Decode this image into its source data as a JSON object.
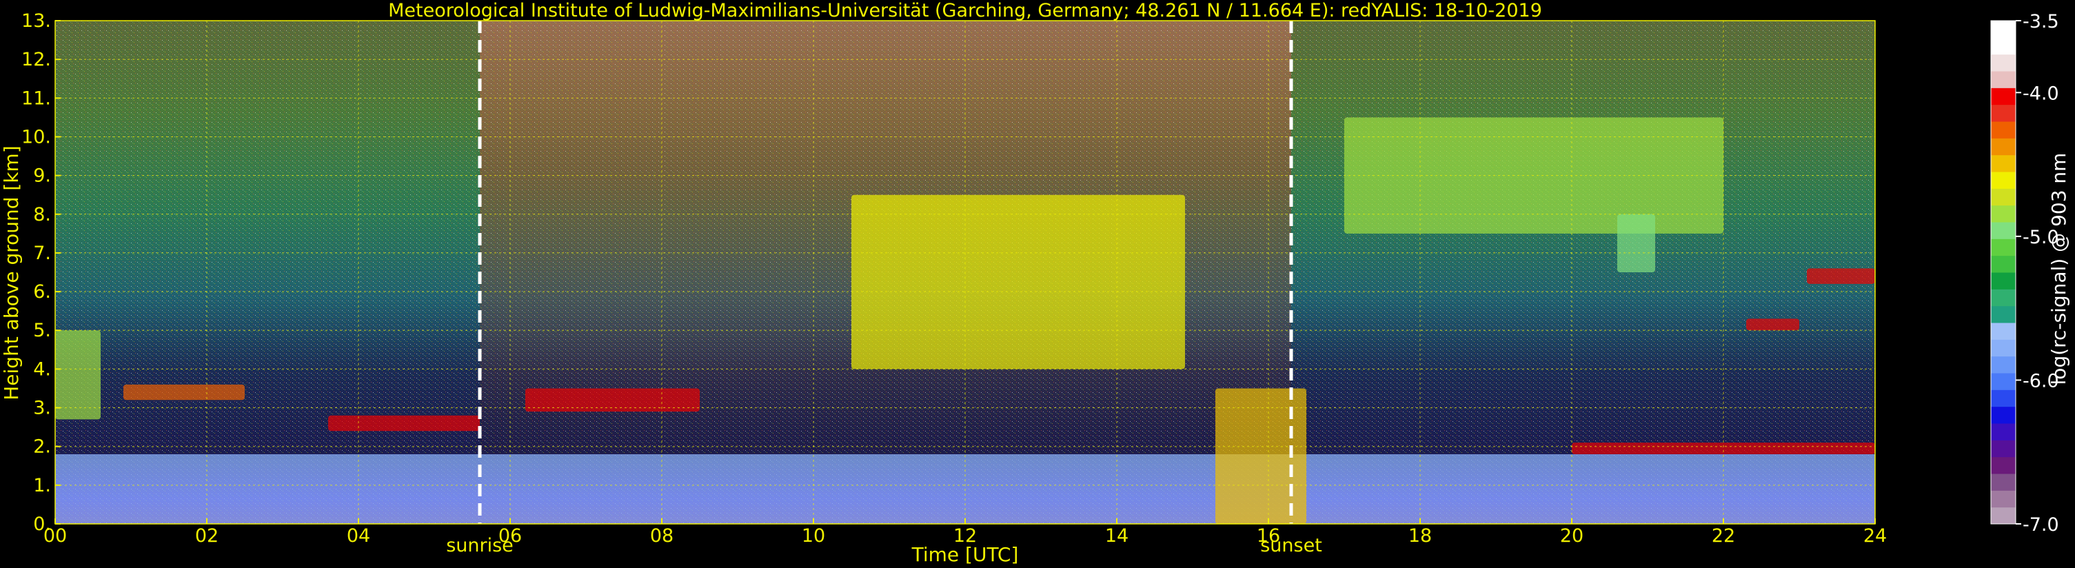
{
  "chart_data": {
    "type": "heatmap",
    "title": "Meteorological Institute of Ludwig-Maximilians-Universität (Garching, Germany; 48.261 N / 11.664 E):    redYALIS: 18-10-2019",
    "xlabel": "Time [UTC]",
    "ylabel": "Height above ground [km]",
    "xlim": [
      0,
      24
    ],
    "ylim": [
      0,
      13
    ],
    "x_ticks": [
      "00",
      "02",
      "04",
      "06",
      "08",
      "10",
      "12",
      "14",
      "16",
      "18",
      "20",
      "22",
      "24"
    ],
    "x_tick_values": [
      0,
      2,
      4,
      6,
      8,
      10,
      12,
      14,
      16,
      18,
      20,
      22,
      24
    ],
    "y_ticks": [
      "0.",
      "1.",
      "2.",
      "3.",
      "4.",
      "5.",
      "6.",
      "7.",
      "8.",
      "9.",
      "10.",
      "11.",
      "12.",
      "13."
    ],
    "y_tick_values": [
      0,
      1,
      2,
      3,
      4,
      5,
      6,
      7,
      8,
      9,
      10,
      11,
      12,
      13
    ],
    "grid": true,
    "markers": [
      {
        "label": "sunrise",
        "x": 5.6
      },
      {
        "label": "sunset",
        "x": 16.3
      }
    ],
    "colorbar": {
      "label": "log(rc-signal) @ 903 nm",
      "ticks": [
        "-3.5",
        "-4.0",
        "-5.0",
        "-6.0",
        "-7.0"
      ],
      "tick_values": [
        -3.5,
        -4.0,
        -5.0,
        -6.0,
        -7.0
      ],
      "range": [
        -7.0,
        -3.5
      ],
      "colors": [
        "#b8a0b8",
        "#a07aa0",
        "#80508a",
        "#6a1a7a",
        "#55109a",
        "#3a10c0",
        "#1010e0",
        "#2a4af0",
        "#4a7af8",
        "#6a98f8",
        "#8ab0f8",
        "#a0c0f8",
        "#20a080",
        "#30b070",
        "#10a040",
        "#40c040",
        "#60d040",
        "#80e080",
        "#a0e040",
        "#d0e020",
        "#f0f000",
        "#f0c000",
        "#f09000",
        "#f06000",
        "#e83020",
        "#f00000",
        "#e8c0c0",
        "#f0e0e0",
        "#ffffff",
        "#ffffff"
      ]
    },
    "features": [
      {
        "name": "boundary-layer",
        "x": [
          0,
          24
        ],
        "y": [
          0,
          1.8
        ],
        "level": -5.8
      },
      {
        "name": "cloud",
        "x": [
          0,
          0.6
        ],
        "y": [
          2.7,
          5.0
        ],
        "level": -4.8
      },
      {
        "name": "cloud",
        "x": [
          0.9,
          2.5
        ],
        "y": [
          3.2,
          3.6
        ],
        "level": -4.2
      },
      {
        "name": "cloud",
        "x": [
          3.6,
          5.6
        ],
        "y": [
          2.4,
          2.8
        ],
        "level": -4.0
      },
      {
        "name": "cloud",
        "x": [
          6.2,
          8.5
        ],
        "y": [
          2.9,
          3.5
        ],
        "level": -4.0
      },
      {
        "name": "cloud",
        "x": [
          10.5,
          14.9
        ],
        "y": [
          4.0,
          8.5
        ],
        "level": -4.6
      },
      {
        "name": "cloud",
        "x": [
          15.3,
          16.5
        ],
        "y": [
          0,
          3.5
        ],
        "level": -4.5
      },
      {
        "name": "cloud",
        "x": [
          17.0,
          22.0
        ],
        "y": [
          7.5,
          10.5
        ],
        "level": -4.8
      },
      {
        "name": "cloud",
        "x": [
          20.6,
          21.1
        ],
        "y": [
          6.5,
          8.0
        ],
        "level": -4.9
      },
      {
        "name": "cloud",
        "x": [
          23.1,
          24
        ],
        "y": [
          6.2,
          6.6
        ],
        "level": -4.0
      },
      {
        "name": "cloud",
        "x": [
          22.3,
          23.0
        ],
        "y": [
          5.0,
          5.3
        ],
        "level": -4.0
      },
      {
        "name": "cloud",
        "x": [
          20.0,
          24
        ],
        "y": [
          1.8,
          2.1
        ],
        "level": -4.0
      }
    ]
  }
}
